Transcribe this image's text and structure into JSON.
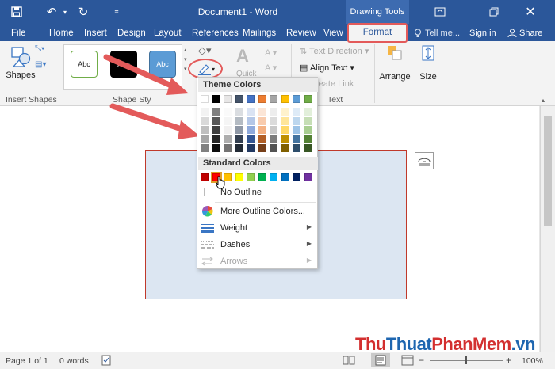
{
  "titlebar": {
    "doc_title": "Document1 - Word",
    "context_tab": "Drawing Tools"
  },
  "tabs": {
    "items": [
      "File",
      "Home",
      "Insert",
      "Design",
      "Layout",
      "References",
      "Mailings",
      "Review",
      "View"
    ],
    "format": "Format",
    "search": "Tell me...",
    "sign_in": "Sign in",
    "share": "Share"
  },
  "ribbon": {
    "shapes_label": "Shapes",
    "insert_shapes_group": "Insert Shapes",
    "shape_styles_group": "Shape Sty",
    "style_swatch_label": "Abc",
    "text_direction": "Text Direction",
    "align_text": "Align Text",
    "create_link": "reate Link",
    "quick": "Quick",
    "text_group": "Text",
    "arrange": "Arrange",
    "size": "Size"
  },
  "menu": {
    "theme_colors": "Theme Colors",
    "standard_colors": "Standard Colors",
    "no_outline": "No Outline",
    "more_colors": "More Outline Colors...",
    "weight": "Weight",
    "dashes": "Dashes",
    "arrows": "Arrows",
    "theme_top_row": [
      "#ffffff",
      "#000000",
      "#e7e6e6",
      "#44546a",
      "#4472c4",
      "#ed7d31",
      "#a5a5a5",
      "#ffc000",
      "#5b9bd5",
      "#70ad47"
    ],
    "standard_row": [
      "#c00000",
      "#ff0000",
      "#ffc000",
      "#ffff00",
      "#92d050",
      "#00b050",
      "#00b0f0",
      "#0070c0",
      "#002060",
      "#7030a0"
    ]
  },
  "statusbar": {
    "page": "Page 1 of 1",
    "words": "0 words",
    "zoom": "100%"
  },
  "watermark": {
    "part1": "Thu",
    "part2": "Thuat",
    "part3": "PhanMem",
    "part4": ".vn"
  },
  "colors": {
    "accent": "#2b579a",
    "highlight": "#e35a5a",
    "shape_fill": "#dce6f2",
    "shape_border": "#c0392b"
  }
}
